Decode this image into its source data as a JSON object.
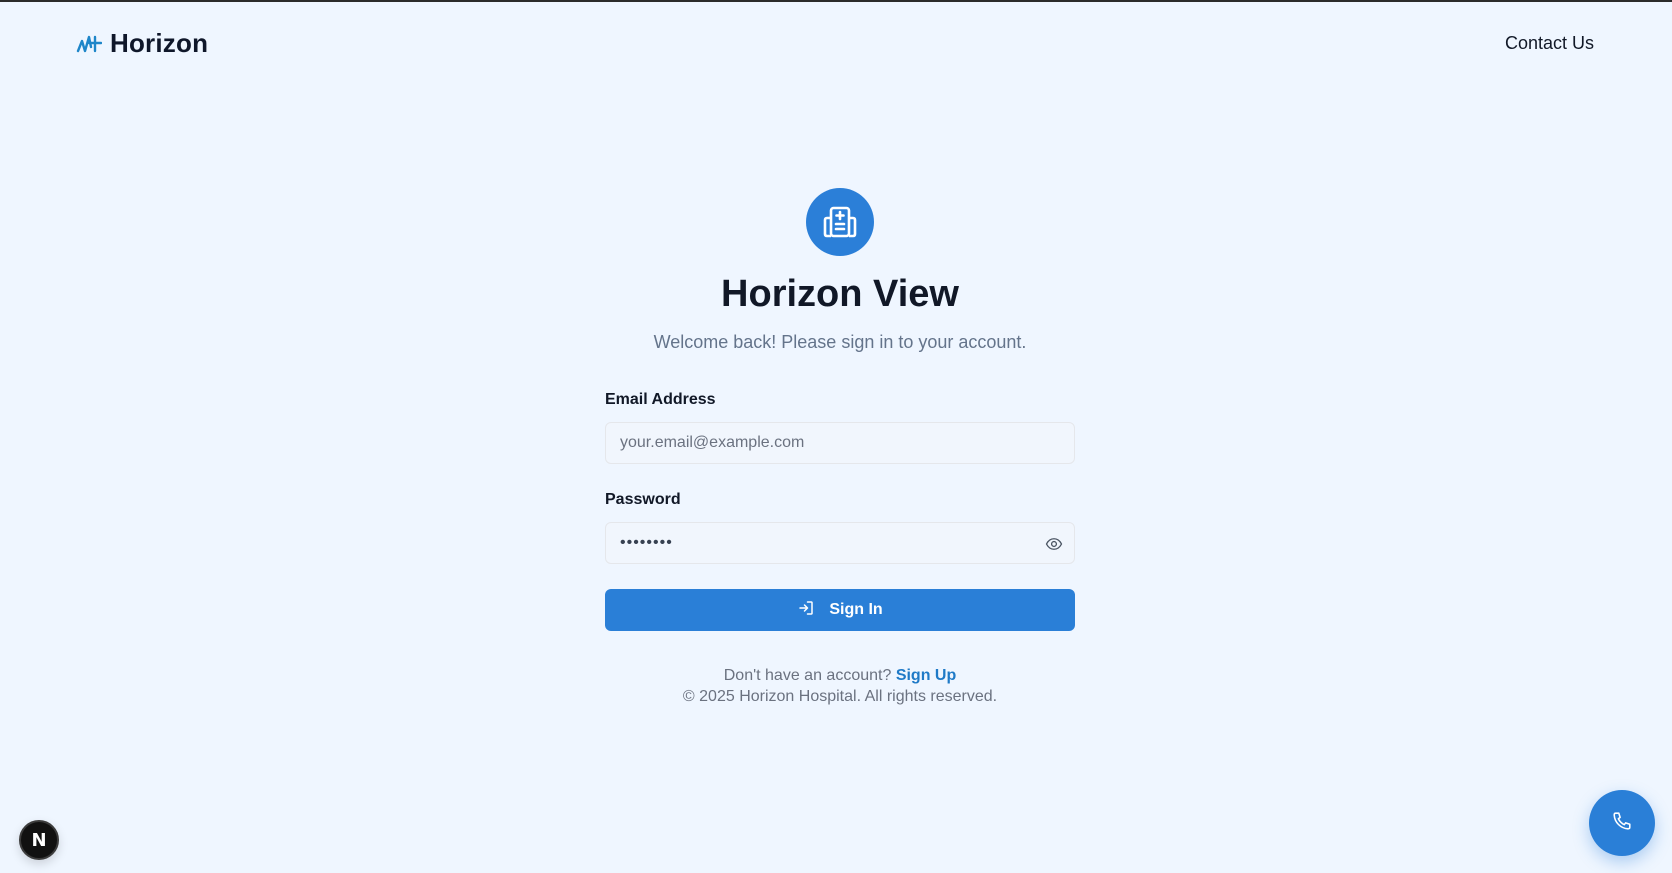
{
  "header": {
    "brand_name": "Horizon",
    "contact_label": "Contact Us"
  },
  "login": {
    "icon": "hospital-building-icon",
    "title": "Horizon View",
    "subtitle": "Welcome back! Please sign in to your account.",
    "email_label": "Email Address",
    "email_placeholder": "your.email@example.com",
    "email_value": "",
    "password_label": "Password",
    "password_value": "••••••••",
    "signin_label": "Sign In",
    "no_account_text": "Don't have an account?",
    "signup_label": "Sign Up",
    "copyright": "© 2025 Horizon Hospital. All rights reserved."
  },
  "widgets": {
    "next_badge_letter": "N",
    "call_icon": "phone-icon"
  },
  "colors": {
    "background": "#eff6ff",
    "primary": "#2a7fd7",
    "link": "#1f7ac7",
    "text": "#111827",
    "muted": "#6b7280"
  }
}
